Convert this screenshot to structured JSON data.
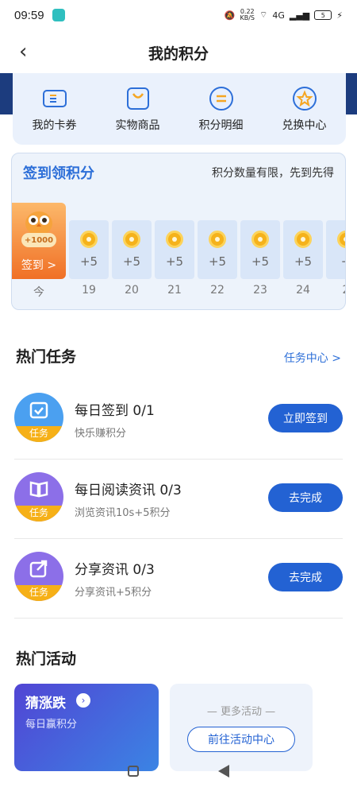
{
  "status": {
    "time": "09:59",
    "speed": "0.22",
    "speed_unit": "KB/S",
    "signal": "4G",
    "battery": "5"
  },
  "nav": {
    "title": "我的积分"
  },
  "quick": [
    {
      "label": "我的卡券",
      "icon": "ticket-icon"
    },
    {
      "label": "实物商品",
      "icon": "bag-icon"
    },
    {
      "label": "积分明细",
      "icon": "exchange-icon"
    },
    {
      "label": "兑换中心",
      "icon": "star-badge-icon"
    }
  ],
  "checkin": {
    "title": "签到领积分",
    "subtitle": "积分数量有限，先到先得",
    "today": {
      "bonus": "+1000",
      "label": "签到 >",
      "day": "今"
    },
    "days": [
      {
        "plus": "+5",
        "day": "19"
      },
      {
        "plus": "+5",
        "day": "20"
      },
      {
        "plus": "+5",
        "day": "21"
      },
      {
        "plus": "+5",
        "day": "22"
      },
      {
        "plus": "+5",
        "day": "23"
      },
      {
        "plus": "+5",
        "day": "24"
      },
      {
        "plus": "+",
        "day": "2"
      }
    ]
  },
  "tasks_section": {
    "title": "热门任务",
    "link": "任务中心 >"
  },
  "tasks": [
    {
      "name": "每日签到 0/1",
      "desc": "快乐赚积分",
      "button": "立即签到",
      "badge": "任务",
      "color": "#4ba0f0"
    },
    {
      "name": "每日阅读资讯 0/3",
      "desc": "浏览资讯10s+5积分",
      "button": "去完成",
      "badge": "任务",
      "color": "#8c6fe8"
    },
    {
      "name": "分享资讯 0/3",
      "desc": "分享资讯+5积分",
      "button": "去完成",
      "badge": "任务",
      "color": "#8c6fe8"
    }
  ],
  "activities_section": {
    "title": "热门活动"
  },
  "activities": {
    "card1": {
      "title": "猜涨跌",
      "subtitle": "每日赢积分"
    },
    "card2": {
      "more": "— 更多活动 —",
      "button": "前往活动中心"
    }
  }
}
